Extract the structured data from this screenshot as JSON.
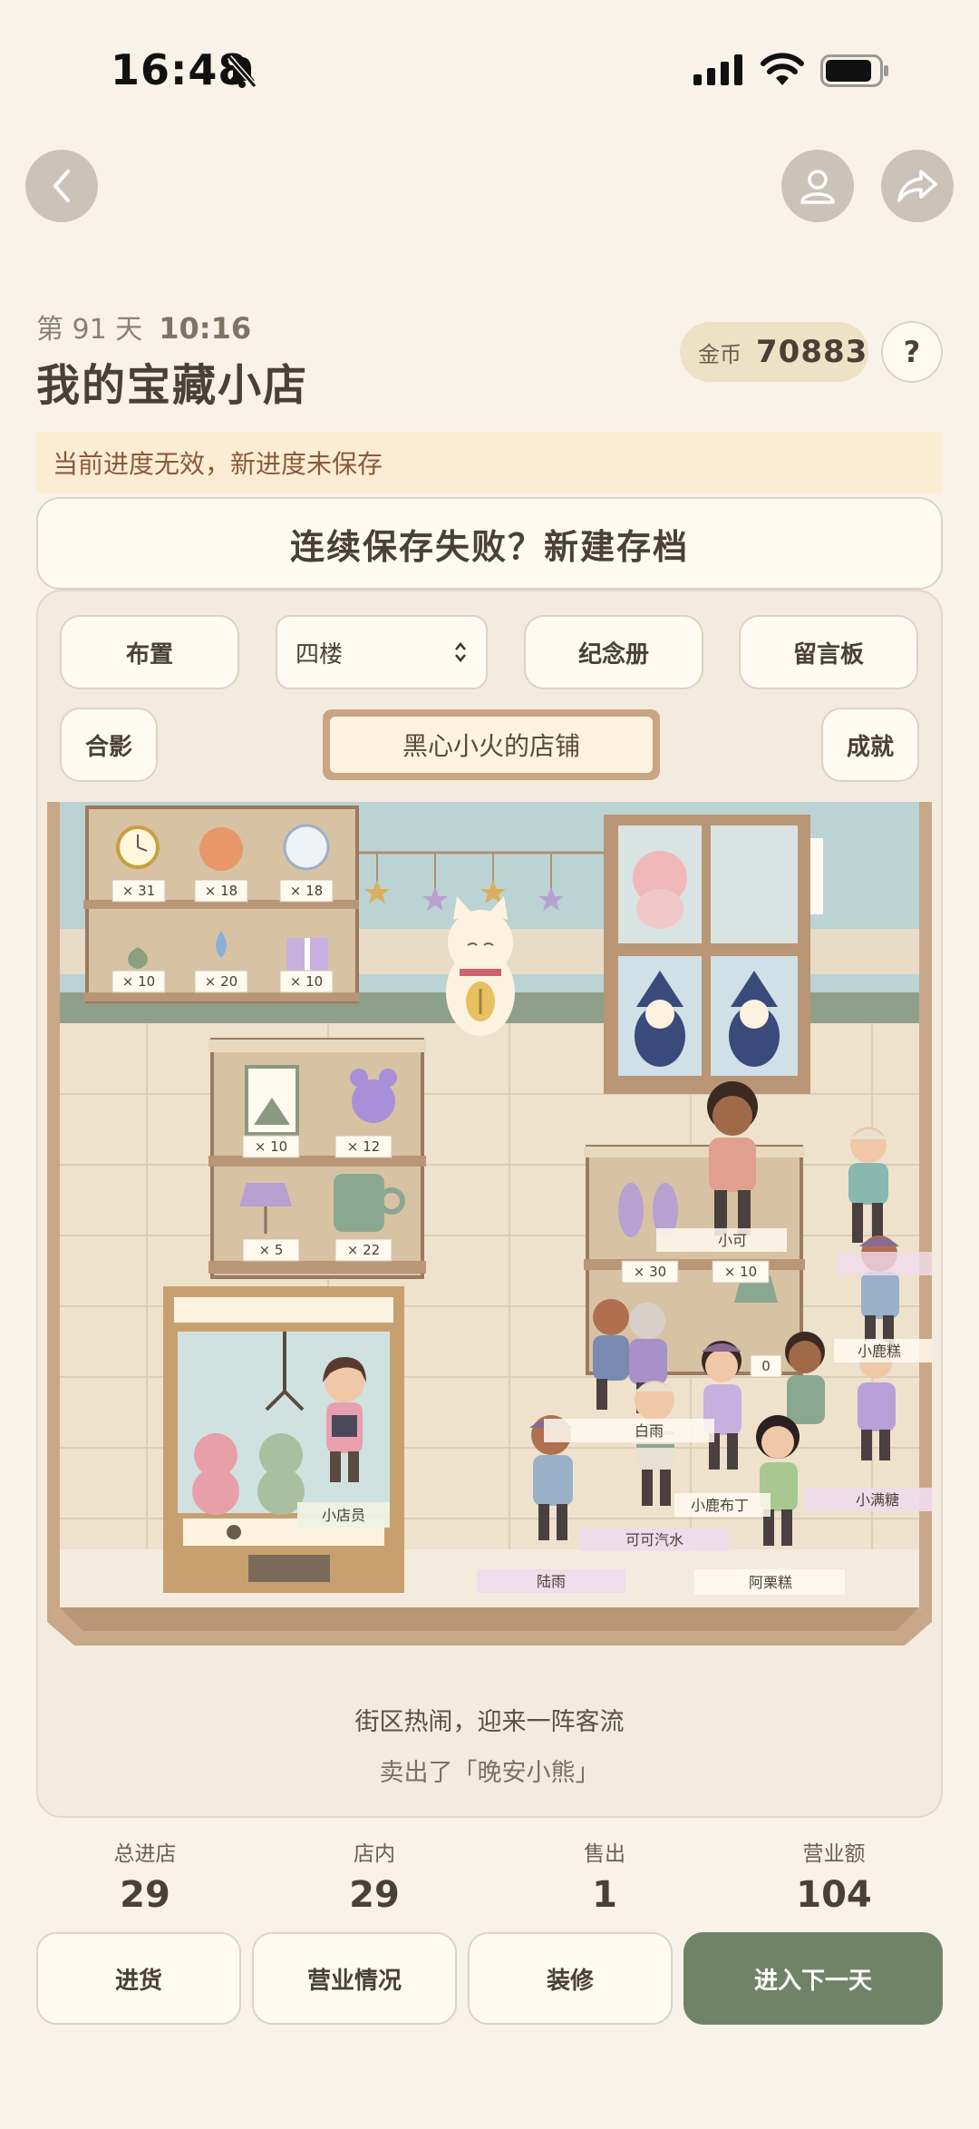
{
  "status_bar": {
    "time": "16:48"
  },
  "header": {
    "day_label": "第 91 天",
    "clock": "10:16",
    "title": "我的宝藏小店",
    "coin_label": "金币",
    "coin_value": "70883",
    "help_label": "?"
  },
  "warning": "当前进度无效，新进度未保存",
  "new_save_button": "连续保存失败？新建存档",
  "toolbar": {
    "layout": "布置",
    "floor_selected": "四楼",
    "album": "纪念册",
    "message_board": "留言板",
    "group_photo": "合影",
    "achievements": "成就",
    "shop_name": "黑心小火的店铺"
  },
  "shelves": {
    "top_left": [
      "× 31",
      "× 18",
      "× 18",
      "× 10",
      "× 20",
      "× 10"
    ],
    "middle": [
      "× 10",
      "× 12",
      "× 5",
      "× 22"
    ],
    "right": [
      "× 30",
      "× 10",
      "0"
    ]
  },
  "characters": [
    "小可",
    "小鹿糕",
    "白雨",
    "小鹿布丁",
    "小满糖",
    "可可汽水",
    "陆雨",
    "阿栗糕",
    "小店员"
  ],
  "messages": {
    "line1": "街区热闹，迎来一阵客流",
    "line2": "卖出了「晚安小熊」"
  },
  "stats": [
    {
      "label": "总进店",
      "value": "29"
    },
    {
      "label": "店内",
      "value": "29"
    },
    {
      "label": "售出",
      "value": "1"
    },
    {
      "label": "营业额",
      "value": "104"
    }
  ],
  "bottom": {
    "restock": "进货",
    "business": "营业情况",
    "decorate": "装修",
    "next_day": "进入下一天"
  },
  "colors": {
    "background": "#f8f2e8",
    "accent_green": "#6f8466",
    "coin_pill": "#eee2c6",
    "warning_bg": "#fbecd4"
  }
}
